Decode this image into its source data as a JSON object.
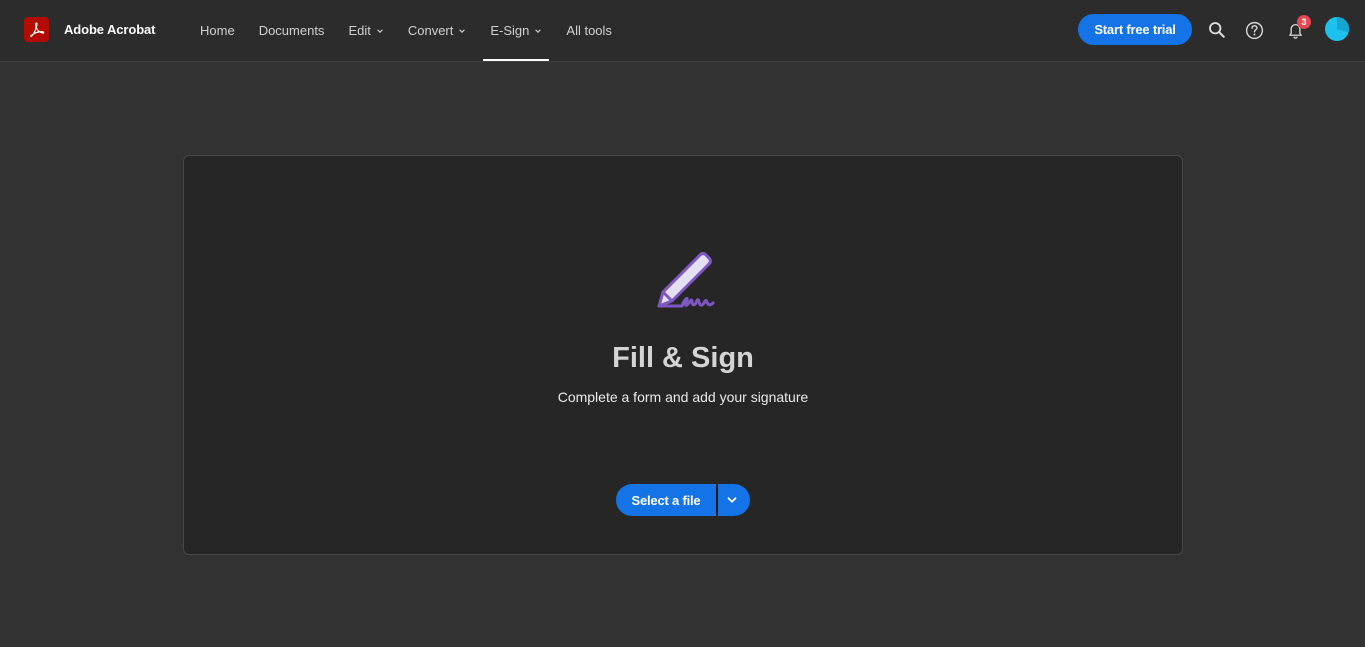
{
  "app": {
    "name": "Adobe Acrobat",
    "logo_icon": "acrobat-logo-icon"
  },
  "nav": {
    "items": [
      {
        "label": "Home",
        "has_dropdown": false,
        "active": false
      },
      {
        "label": "Documents",
        "has_dropdown": false,
        "active": false
      },
      {
        "label": "Edit",
        "has_dropdown": true,
        "active": false
      },
      {
        "label": "Convert",
        "has_dropdown": true,
        "active": false
      },
      {
        "label": "E-Sign",
        "has_dropdown": true,
        "active": true
      },
      {
        "label": "All tools",
        "has_dropdown": false,
        "active": false
      }
    ]
  },
  "header_actions": {
    "trial_label": "Start free trial",
    "search_icon": "search-icon",
    "help_icon": "help-icon",
    "notifications_icon": "bell-icon",
    "notification_count": "3",
    "avatar_icon": "user-avatar"
  },
  "tool": {
    "icon": "fill-sign-pen-icon",
    "title": "Fill & Sign",
    "description": "Complete a form and add your signature",
    "primary_action": "Select a file",
    "dropdown_icon": "chevron-down-icon"
  },
  "colors": {
    "accent": "#1473e6",
    "brand_red": "#b30b00",
    "icon_purple": "#7e57c2",
    "badge_red": "#e34850",
    "avatar_cyan": "#1ec0ee"
  }
}
